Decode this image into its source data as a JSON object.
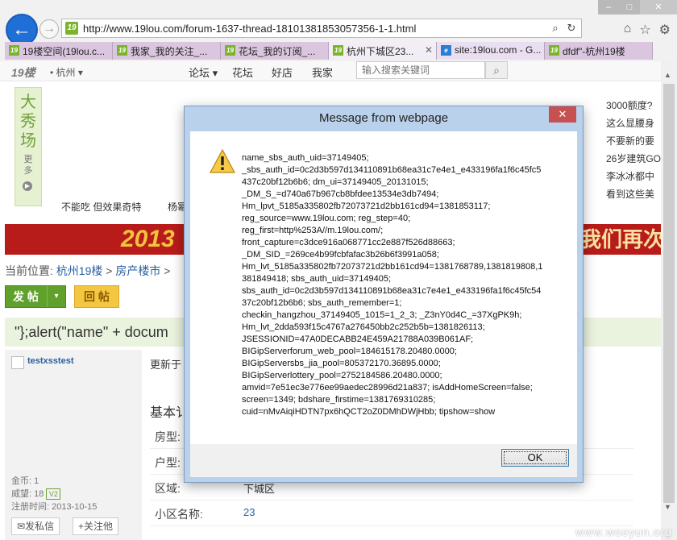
{
  "browser": {
    "url": "http://www.19lou.com/forum-1637-thread-18101381853057356-1-1.html",
    "favicon_text": "19",
    "tabs": [
      {
        "label": "19楼空间(19lou.c..."
      },
      {
        "label": "我家_我的关注_..."
      },
      {
        "label": "花坛_我的订阅_..."
      },
      {
        "label": "杭州下城区23..."
      },
      {
        "label": "site:19lou.com - G..."
      },
      {
        "label": "dfdf\"-杭州19楼"
      }
    ],
    "active_tab_index": 3
  },
  "site": {
    "logo": "19楼",
    "city": "• 杭州 ▾",
    "nav": [
      "论坛 ▾",
      "花坛",
      "好店",
      "我家"
    ],
    "search_placeholder": "输入搜索关键词",
    "ad_chars": "大秀场",
    "ad_more": "更多",
    "promo_left": "不能吃  但效果奇特",
    "promo_right": "杨幂",
    "right_list": [
      "3000额度?",
      "这么显腰身",
      "不要新的要",
      "26岁建筑GO",
      "李冰冰都中",
      "看到这些美"
    ],
    "banner_left": "2013",
    "banner_right": "我们再次",
    "breadcrumb": {
      "label": "当前位置:",
      "items": [
        "杭州19楼",
        "房产楼市"
      ]
    },
    "post_button": "发 帖",
    "reply_button": "回 帖",
    "post_title": "\"};alert(\"name\" + docum",
    "user": {
      "name": "testxsstest",
      "gold": "金币:  1",
      "prestige": "威望:  18",
      "vip": "V2",
      "registered": "注册时间:  2013-10-15",
      "send_msg": "发私信",
      "follow": "关注他"
    },
    "updated": "更新于",
    "basic_info": "基本讠",
    "rows": [
      {
        "key": "房型:",
        "value": ""
      },
      {
        "key": "户型:",
        "value": ""
      },
      {
        "key": "区域:",
        "value": "下城区"
      },
      {
        "key": "小区名称:",
        "value": "23"
      }
    ]
  },
  "dialog": {
    "title": "Message from webpage",
    "lines": [
      "name_sbs_auth_uid=37149405;",
      "_sbs_auth_id=0c2d3b597d134110891b68ea31c7e4e1_e433196fa1f6c45fc5",
      "437c20bf12b6b6; dm_ui=37149405_20131015;",
      "_DM_S_=d740a67b967cb8bfdee13534e3db7494;",
      "Hm_lpvt_5185a335802fb72073721d2bb161cd94=1381853117;",
      "reg_source=www.19lou.com; reg_step=40;",
      "reg_first=http%253A//m.19lou.com/;",
      "front_capture=c3dce916a068771cc2e887f526d88663;",
      "_DM_SID_=269ce4b99fcbfafac3b26b6f3991a058;",
      "Hm_lvt_5185a335802fb72073721d2bb161cd94=1381768789,1381819808,1",
      "381849418; sbs_auth_uid=37149405;",
      "sbs_auth_id=0c2d3b597d134110891b68ea31c7e4e1_e433196fa1f6c45fc54",
      "37c20bf12b6b6; sbs_auth_remember=1;",
      "checkin_hangzhou_37149405_1015=1_2_3; _Z3nY0d4C_=37XgPK9h;",
      "Hm_lvt_2dda593f15c4767a276450bb2c252b5b=1381826113;",
      "JSESSIONID=47A0DECABB24E459A21788A039B061AF;",
      "BIGipServerforum_web_pool=184615178.20480.0000;",
      "BIGipServersbs_jia_pool=805372170.36895.0000;",
      "BIGipServerlottery_pool=2752184586.20480.0000;",
      "amvid=7e51ec3e776ee99aedec28996d21a837; isAddHomeScreen=false;",
      "screen=1349; bdshare_firstime=1381769310285;",
      "cuid=nMvAiqiHDTN7px6hQCT2oZ0DMhDWjHbb; tipshow=show"
    ],
    "ok_label": "OK",
    "close_label": "✕"
  },
  "watermark": "www.wooyun.org",
  "colors": {
    "accent": "#1f6fd6",
    "site_green": "#5fa12b",
    "dialog_frame": "#b9d1ea"
  }
}
